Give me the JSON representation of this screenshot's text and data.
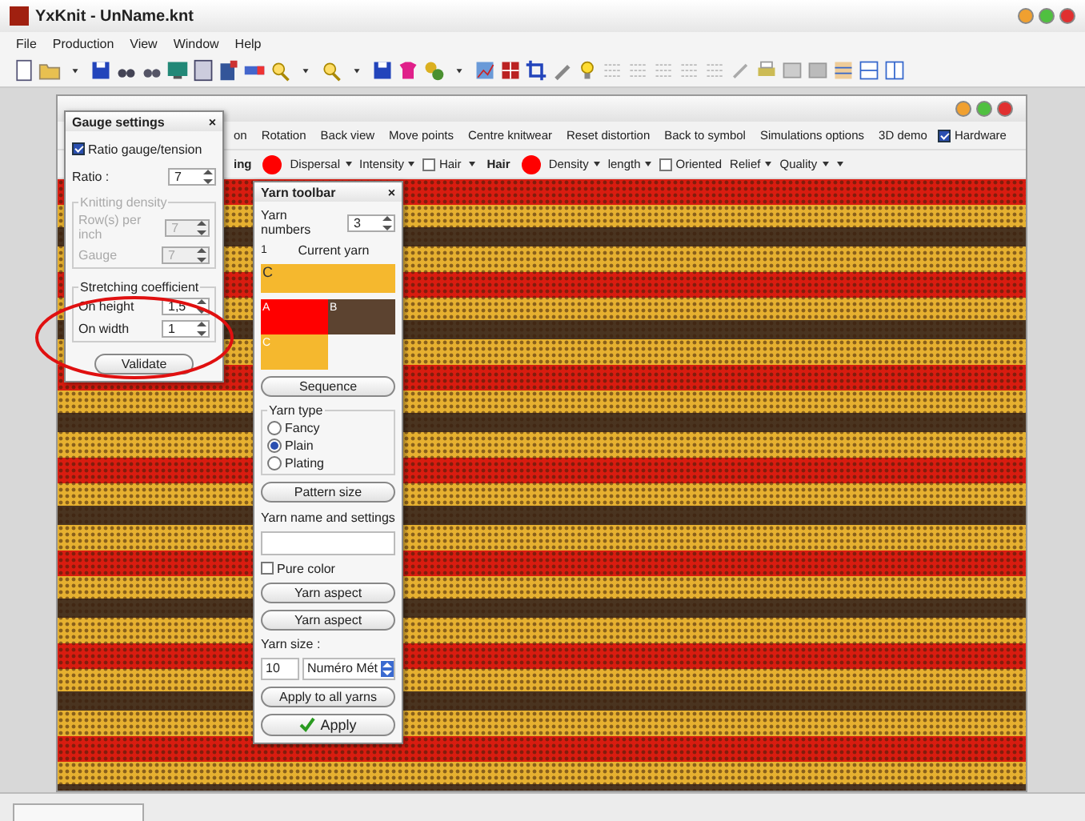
{
  "window": {
    "title": "YxKnit - UnName.knt"
  },
  "menu": [
    {
      "label": "File",
      "disabled": false
    },
    {
      "label": "Production",
      "disabled": false
    },
    {
      "label": "View",
      "disabled": false
    },
    {
      "label": "Window",
      "disabled": false
    },
    {
      "label": "Help",
      "disabled": false
    }
  ],
  "document": {
    "toolbar_row1": [
      {
        "kind": "text",
        "label": "on"
      },
      {
        "kind": "text",
        "label": "Rotation"
      },
      {
        "kind": "text",
        "label": "Back view"
      },
      {
        "kind": "text",
        "label": "Move points"
      },
      {
        "kind": "text",
        "label": "Centre knitwear"
      },
      {
        "kind": "text",
        "label": "Reset distortion"
      },
      {
        "kind": "text",
        "label": "Back to symbol"
      },
      {
        "kind": "text",
        "label": "Simulations options"
      },
      {
        "kind": "text",
        "label": "3D demo"
      },
      {
        "kind": "check",
        "label": "Hardware",
        "checked": true
      }
    ],
    "toolbar_row2": [
      {
        "kind": "bold",
        "label": "ing"
      },
      {
        "kind": "dot",
        "color": "#ff0000"
      },
      {
        "kind": "dropdown",
        "label": "Dispersal"
      },
      {
        "kind": "dropdown",
        "label": "Intensity"
      },
      {
        "kind": "check",
        "label": "Hair",
        "checked": false
      },
      {
        "kind": "dropdown"
      },
      {
        "kind": "bold",
        "label": "Hair"
      },
      {
        "kind": "dot",
        "color": "#ff0000"
      },
      {
        "kind": "dropdown",
        "label": "Density"
      },
      {
        "kind": "dropdown",
        "label": "length"
      },
      {
        "kind": "check",
        "label": "Oriented",
        "checked": false
      },
      {
        "kind": "dropdown",
        "label": "Relief"
      },
      {
        "kind": "dropdown",
        "label": "Quality"
      },
      {
        "kind": "dropdown"
      }
    ]
  },
  "gauge_settings": {
    "title": "Gauge settings",
    "close_glyph": "×",
    "ratio_check": {
      "label": "Ratio gauge/tension",
      "checked": true
    },
    "ratio": {
      "label": "Ratio :",
      "value": "7"
    },
    "knitting_density": {
      "title": "Knitting density",
      "disabled": true,
      "fields": [
        {
          "label": "Row(s) per inch",
          "value": "7"
        },
        {
          "label": "Gauge",
          "value": "7"
        }
      ]
    },
    "stretching": {
      "title": "Stretching coefficient",
      "disabled": false,
      "fields": [
        {
          "label": "On height",
          "value": "1,5"
        },
        {
          "label": "On width",
          "value": "1"
        }
      ]
    },
    "button": "Validate"
  },
  "yarn_toolbar": {
    "title": "Yarn toolbar",
    "close_glyph": "×",
    "numbers_label": "Yarn numbers",
    "numbers_value": "3",
    "index": "1",
    "current_label": "Current yarn",
    "current": {
      "letter": "C",
      "color": "#f5b82e"
    },
    "yarns": [
      {
        "letter": "A",
        "color": "#ff0000"
      },
      {
        "letter": "B",
        "color": "#5c4330"
      },
      {
        "letter": "C",
        "color": "#f5b82e"
      }
    ],
    "sequence_button": "Sequence",
    "type_title": "Yarn type",
    "types": [
      {
        "label": "Fancy",
        "selected": false
      },
      {
        "label": "Plain",
        "selected": true
      },
      {
        "label": "Plating",
        "selected": false
      }
    ],
    "pattern_button": "Pattern size",
    "name_label": "Yarn name and settings",
    "pure_color": {
      "label": "Pure color",
      "checked": false
    },
    "aspect_buttons": [
      "Yarn aspect",
      "Yarn aspect"
    ],
    "size_label": "Yarn size :",
    "size_value": "10",
    "size_unit": "Numéro Mét",
    "apply_all_button": "Apply to all yarns",
    "apply_button": "Apply"
  }
}
